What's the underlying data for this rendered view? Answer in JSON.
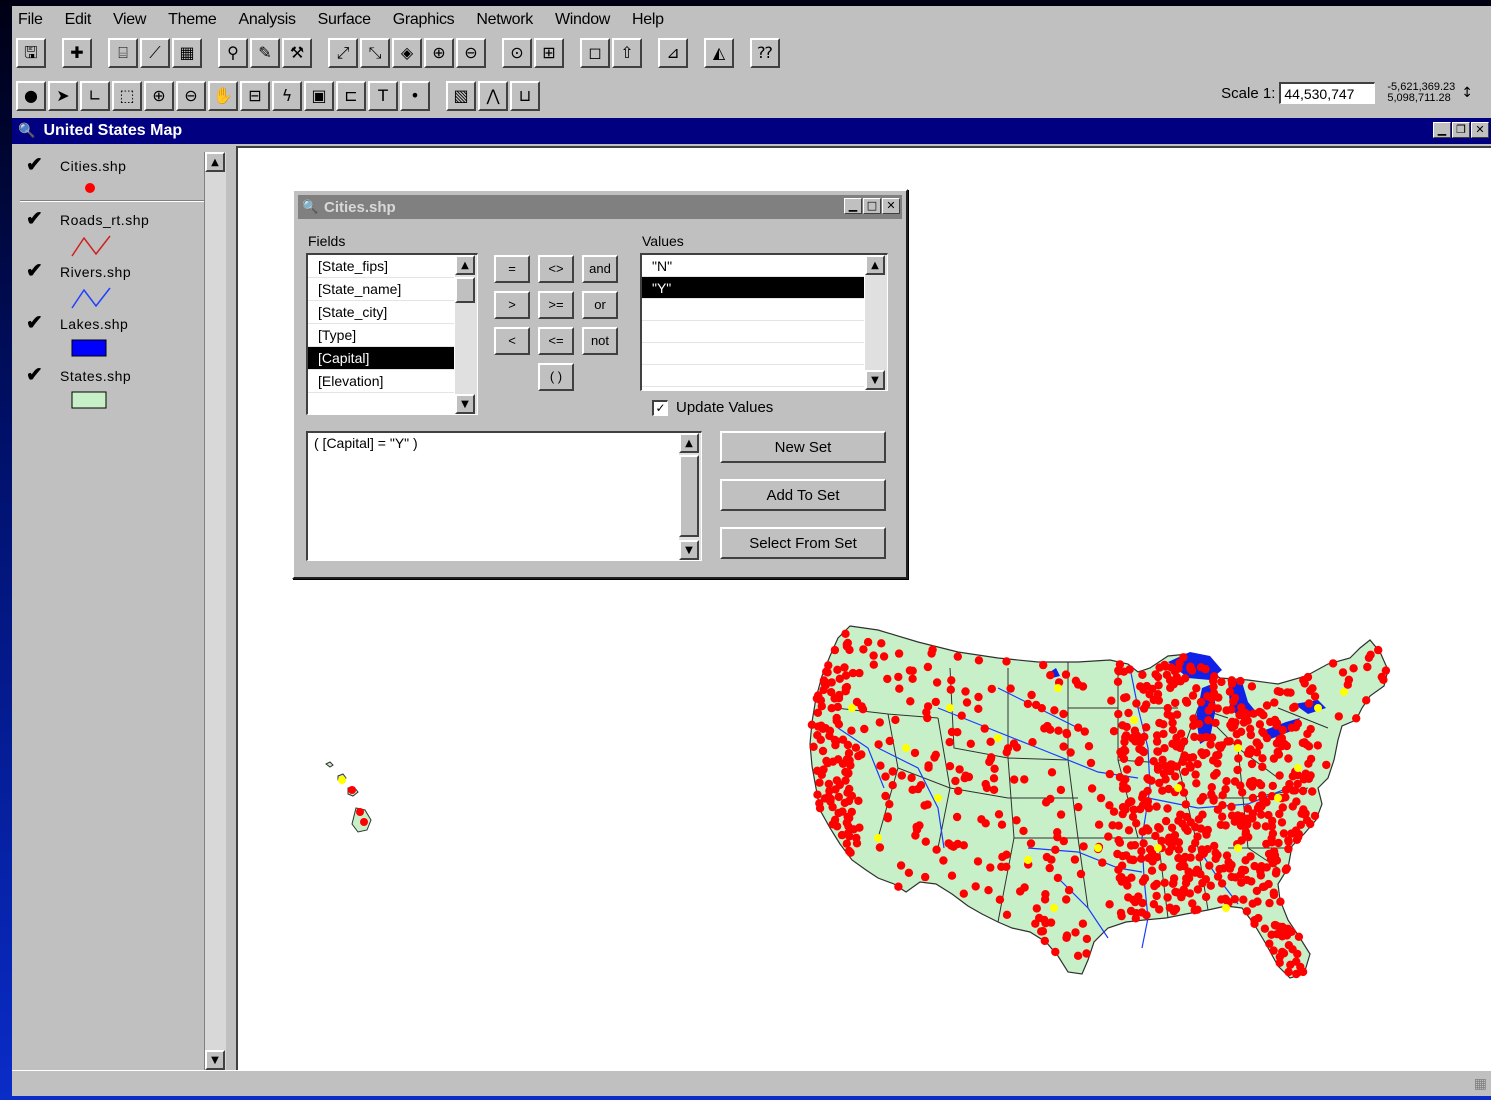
{
  "menu": [
    {
      "label": "File"
    },
    {
      "label": "Edit"
    },
    {
      "label": "View"
    },
    {
      "label": "Theme"
    },
    {
      "label": "Analysis"
    },
    {
      "label": "Surface"
    },
    {
      "label": "Graphics"
    },
    {
      "label": "Network"
    },
    {
      "label": "Window"
    },
    {
      "label": "Help"
    }
  ],
  "toolbar1": [
    {
      "name": "save-icon",
      "glyph": "🖫"
    },
    {
      "name": "add-theme-icon",
      "glyph": "✚"
    },
    {
      "name": "theme-properties-icon",
      "glyph": "⌸"
    },
    {
      "name": "edit-legend-icon",
      "glyph": "⟋"
    },
    {
      "name": "open-table-icon",
      "glyph": "▦"
    },
    {
      "name": "find-icon",
      "glyph": "⚲"
    },
    {
      "name": "locate-address-icon",
      "glyph": "✎"
    },
    {
      "name": "query-builder-icon",
      "glyph": "⚒"
    },
    {
      "name": "zoom-full-extent-icon",
      "glyph": "⤢"
    },
    {
      "name": "zoom-active-themes-icon",
      "glyph": "⤡"
    },
    {
      "name": "zoom-selected-icon",
      "glyph": "◈"
    },
    {
      "name": "zoom-in-fixed-icon",
      "glyph": "⊕"
    },
    {
      "name": "zoom-out-fixed-icon",
      "glyph": "⊖"
    },
    {
      "name": "zoom-previous-icon",
      "glyph": "⊙"
    },
    {
      "name": "select-features-icon",
      "glyph": "⊞"
    },
    {
      "name": "clear-selection-icon",
      "glyph": "◻"
    },
    {
      "name": "promote-icon",
      "glyph": "⇧"
    },
    {
      "name": "chart-icon",
      "glyph": "⊿"
    },
    {
      "name": "layout-icon",
      "glyph": "◭"
    },
    {
      "name": "help-icon",
      "glyph": "⁇"
    }
  ],
  "toolbar2": [
    {
      "name": "identify-icon",
      "glyph": "●"
    },
    {
      "name": "pointer-icon",
      "glyph": "➤"
    },
    {
      "name": "vertex-edit-icon",
      "glyph": "∟"
    },
    {
      "name": "select-feature-icon",
      "glyph": "⬚"
    },
    {
      "name": "zoom-in-icon",
      "glyph": "⊕"
    },
    {
      "name": "zoom-out-icon",
      "glyph": "⊖"
    },
    {
      "name": "pan-icon",
      "glyph": "✋"
    },
    {
      "name": "measure-icon",
      "glyph": "⊟"
    },
    {
      "name": "hotlink-icon",
      "glyph": "ϟ"
    },
    {
      "name": "area-of-interest-icon",
      "glyph": "▣"
    },
    {
      "name": "label-icon",
      "glyph": "⊏"
    },
    {
      "name": "text-tool-icon",
      "glyph": "T"
    },
    {
      "name": "draw-point-icon",
      "glyph": "•"
    },
    {
      "name": "snap-icon",
      "glyph": "▧"
    },
    {
      "name": "split-icon",
      "glyph": "⋀"
    },
    {
      "name": "union-icon",
      "glyph": "⊔"
    }
  ],
  "scale": {
    "label": "Scale 1:",
    "value": "44,530,747"
  },
  "coords": {
    "x": "-5,621,369.23",
    "y": "5,098,711.28"
  },
  "view": {
    "title": "United States Map"
  },
  "themes": [
    {
      "name": "Cities.shp",
      "check": "✔",
      "symbol": "point",
      "color": "#ff0000"
    },
    {
      "name": "Roads_rt.shp",
      "check": "✔",
      "symbol": "line",
      "color": "#d02020"
    },
    {
      "name": "Rivers.shp",
      "check": "✔",
      "symbol": "line",
      "color": "#2040ff"
    },
    {
      "name": "Lakes.shp",
      "check": "✔",
      "symbol": "fill",
      "color": "#0000ff"
    },
    {
      "name": "States.shp",
      "check": "✔",
      "symbol": "fill",
      "color": "#c8f0c8"
    }
  ],
  "query": {
    "title": "Cities.shp",
    "fields_label": "Fields",
    "values_label": "Values",
    "fields": [
      "[State_fips]",
      "[State_name]",
      "[State_city]",
      "[Type]",
      "[Capital]",
      "[Elevation]"
    ],
    "fields_selected": 4,
    "values": [
      "\"N\"",
      "\"Y\"",
      "",
      "",
      "",
      ""
    ],
    "values_selected": 1,
    "operators": [
      "=",
      "<>",
      "and",
      ">",
      ">=",
      "or",
      "<",
      "<=",
      "not",
      "( )"
    ],
    "update_values_label": "Update Values",
    "update_values_checked": true,
    "expression": "( [Capital] = \"Y\" )",
    "buttons": {
      "new_set": "New Set",
      "add_to_set": "Add To Set",
      "select_from_set": "Select From Set"
    }
  },
  "map_colors": {
    "states_fill": "#c8f0c8",
    "state_border": "#303030",
    "rivers": "#1a3cff",
    "lakes": "#1020e8",
    "cities": "#ff0000",
    "capitals": "#ffff00"
  }
}
